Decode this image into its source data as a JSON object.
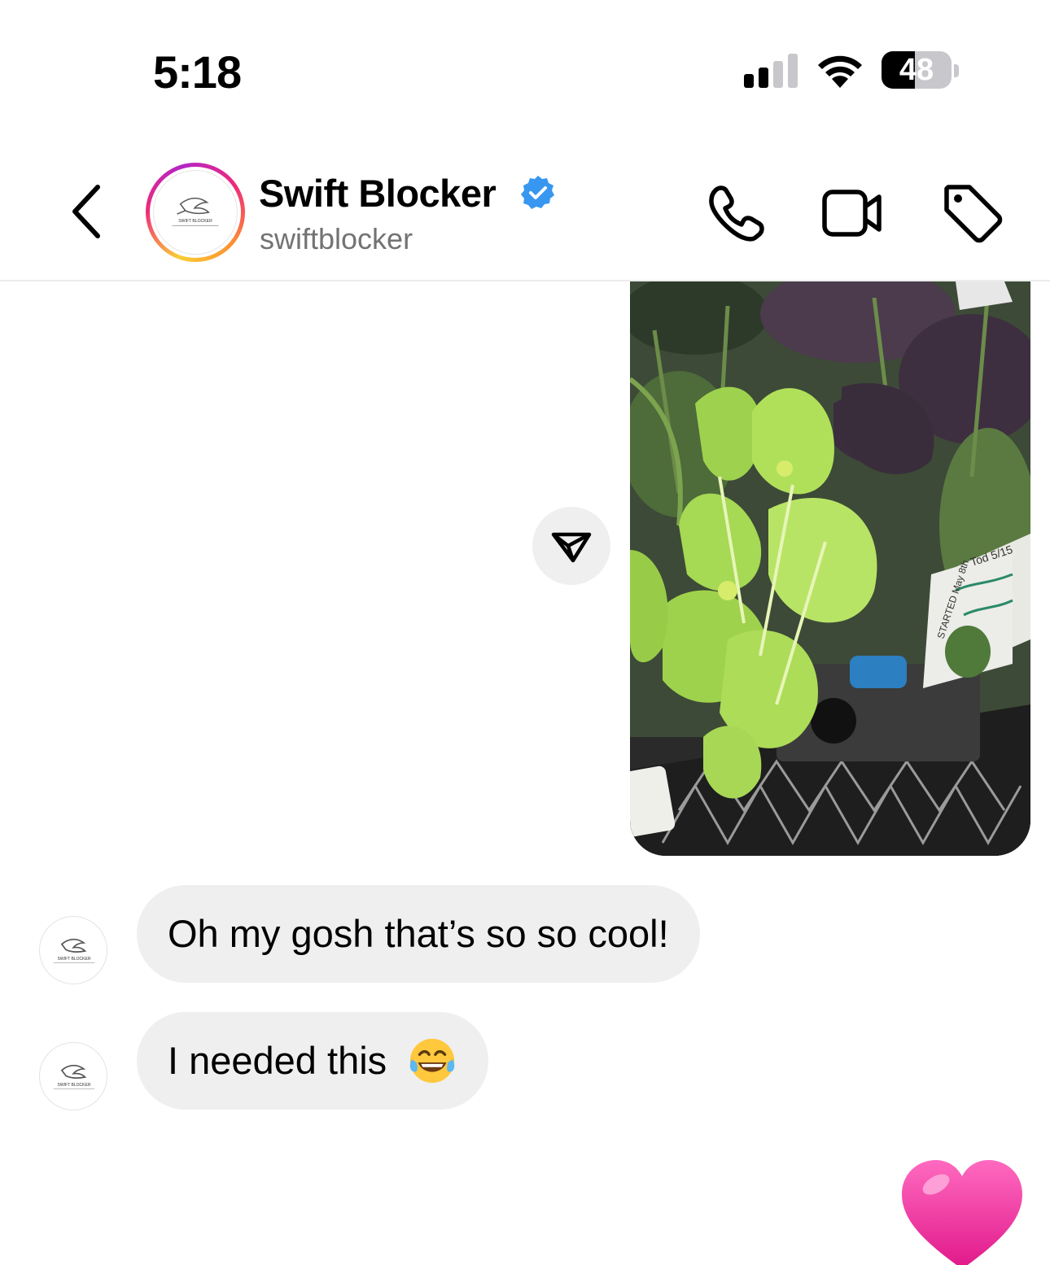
{
  "status_bar": {
    "time": "5:18",
    "battery_level": "48",
    "battery_fraction": 0.48,
    "signal_bars_active": 2,
    "signal_bars_total": 4
  },
  "header": {
    "contact_name": "Swift Blocker",
    "contact_handle": "swiftblocker",
    "verified": true,
    "logo_text": "SWIFT BLOCKER",
    "icons": [
      "chevron-left-icon",
      "phone-icon",
      "video-camera-icon",
      "tag-icon"
    ]
  },
  "messages": [
    {
      "type": "shared-image",
      "from": "me",
      "image_caption_note": "Tod 5/15",
      "image_label": "STARTED May 8th"
    },
    {
      "type": "text",
      "from": "swiftblocker",
      "text": "Oh my gosh that’s so so cool!"
    },
    {
      "type": "text",
      "from": "swiftblocker",
      "text": "I needed this",
      "emoji": "tears-of-joy-emoji"
    },
    {
      "type": "reaction",
      "from": "me",
      "emoji": "pink-heart-emoji"
    }
  ],
  "colors": {
    "verified_blue": "#3897f0",
    "bubble_gray": "#efefef",
    "handle_gray": "#737373",
    "heart_pink": "#f0329a"
  }
}
